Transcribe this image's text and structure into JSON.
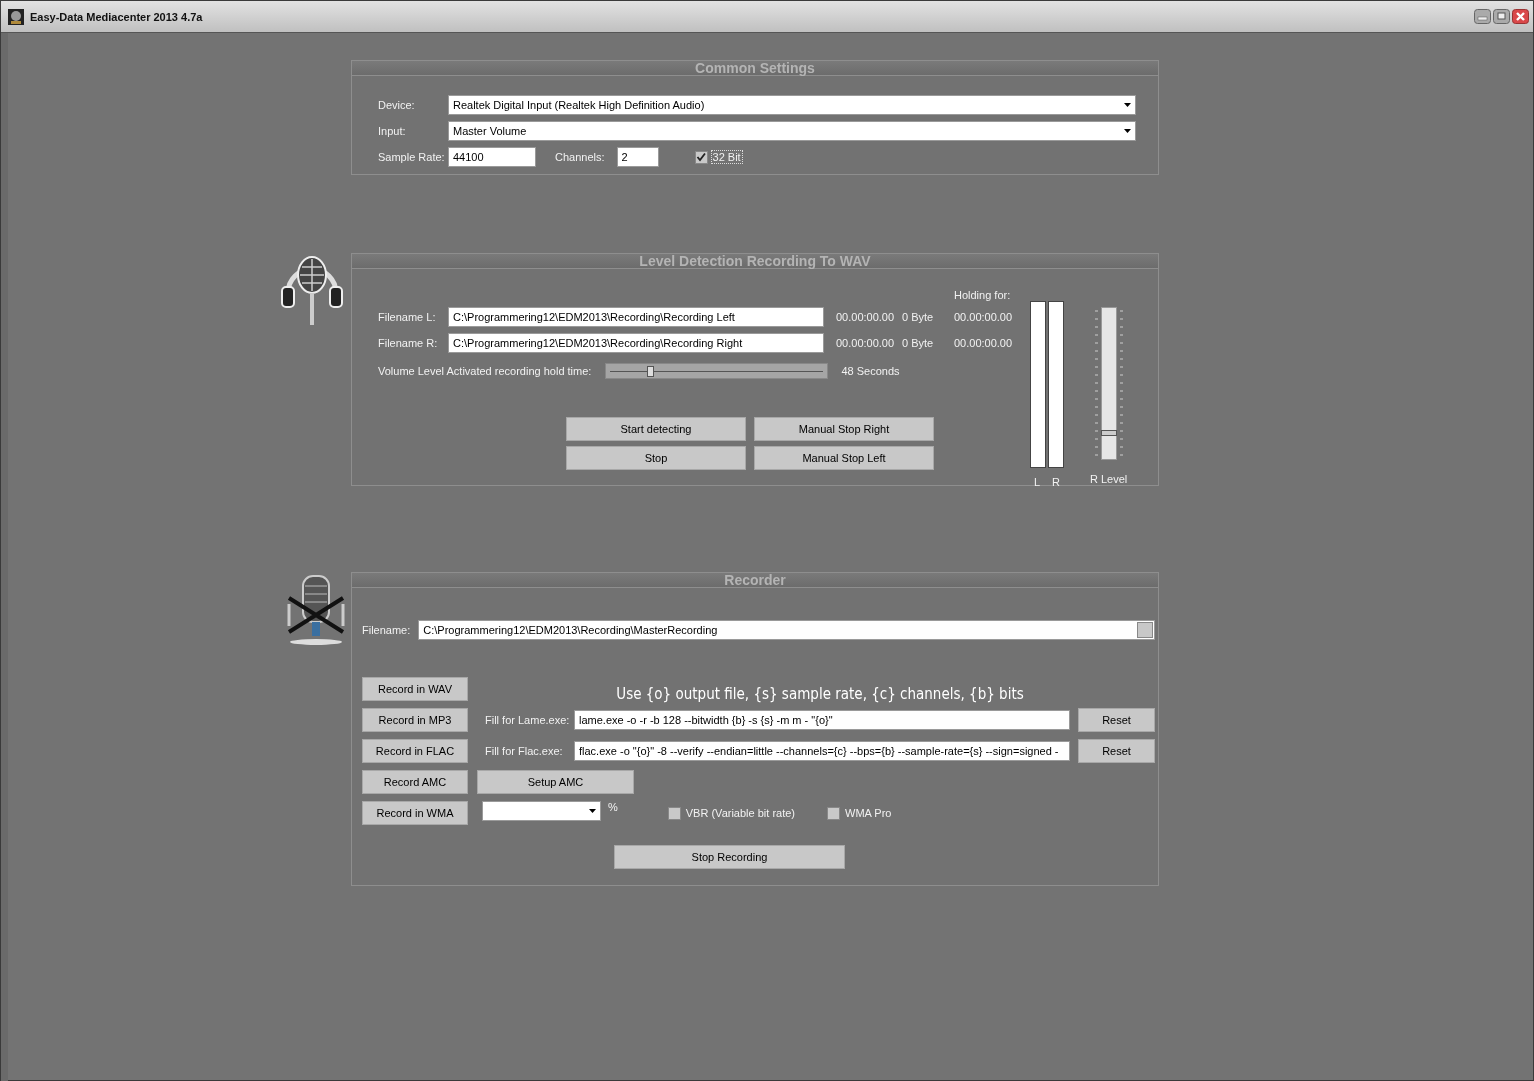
{
  "window": {
    "title": "Easy-Data Mediacenter 2013 4.7a"
  },
  "common_settings": {
    "title": "Common Settings",
    "device": {
      "label": "Device:",
      "value": "Realtek Digital Input (Realtek High Definition Audio)"
    },
    "input": {
      "label": "Input:",
      "value": "Master Volume"
    },
    "sample_rate": {
      "label": "Sample Rate:",
      "value": "44100"
    },
    "channels": {
      "label": "Channels:",
      "value": "2"
    },
    "bit_depth": {
      "label": "32 Bit",
      "checked": true
    }
  },
  "level_detection": {
    "title": "Level Detection Recording To WAV",
    "holding_label": "Holding for:",
    "files": [
      {
        "label": "Filename L:",
        "value": "C:\\Programmering12\\EDM2013\\Recording\\Recording Left",
        "time": "00.00:00.00",
        "size": "0 Byte",
        "holding": "00.00:00.00"
      },
      {
        "label": "Filename R:",
        "value": "C:\\Programmering12\\EDM2013\\Recording\\Recording Right",
        "time": "00.00:00.00",
        "size": "0 Byte",
        "holding": "00.00:00.00"
      }
    ],
    "hold_time": {
      "label": "Volume Level Activated recording hold time:",
      "level": 0.19,
      "reading": "48 Seconds"
    },
    "buttons": [
      "Start detecting",
      "Manual Stop Right",
      "Stop",
      "Manual Stop Left"
    ],
    "meters": [
      {
        "label": "L"
      },
      {
        "label": "R"
      }
    ],
    "r_level": {
      "label": "R Level",
      "level": 0.17
    }
  },
  "recorder": {
    "title": "Recorder",
    "filename": {
      "label": "Filename:",
      "value": "C:\\Programmering12\\EDM2013\\Recording\\MasterRecording"
    },
    "hint": "Use {o} output file, {s} sample rate, {c} channels, {b} bits",
    "format_buttons": [
      "Record in WAV",
      "Record in MP3",
      "Record in FLAC",
      "Record AMC",
      "Record in WMA"
    ],
    "lame": {
      "label": "Fill for Lame.exe:",
      "value": "lame.exe -o -r -b 128 --bitwidth {b} -s {s} -m m - \"{o}\"",
      "reset": "Reset"
    },
    "flac": {
      "label": "Fill for Flac.exe:",
      "value": "flac.exe -o \"{o}\" -8 --verify --endian=little --channels={c} --bps={b} --sample-rate={s} --sign=signed -",
      "reset": "Reset"
    },
    "setup_amc": "Setup AMC",
    "percent": "%",
    "vbr": {
      "label": "VBR (Variable bit rate)",
      "checked": false
    },
    "wma_pro": {
      "label": "WMA Pro",
      "checked": false
    },
    "stop": "Stop Recording"
  }
}
